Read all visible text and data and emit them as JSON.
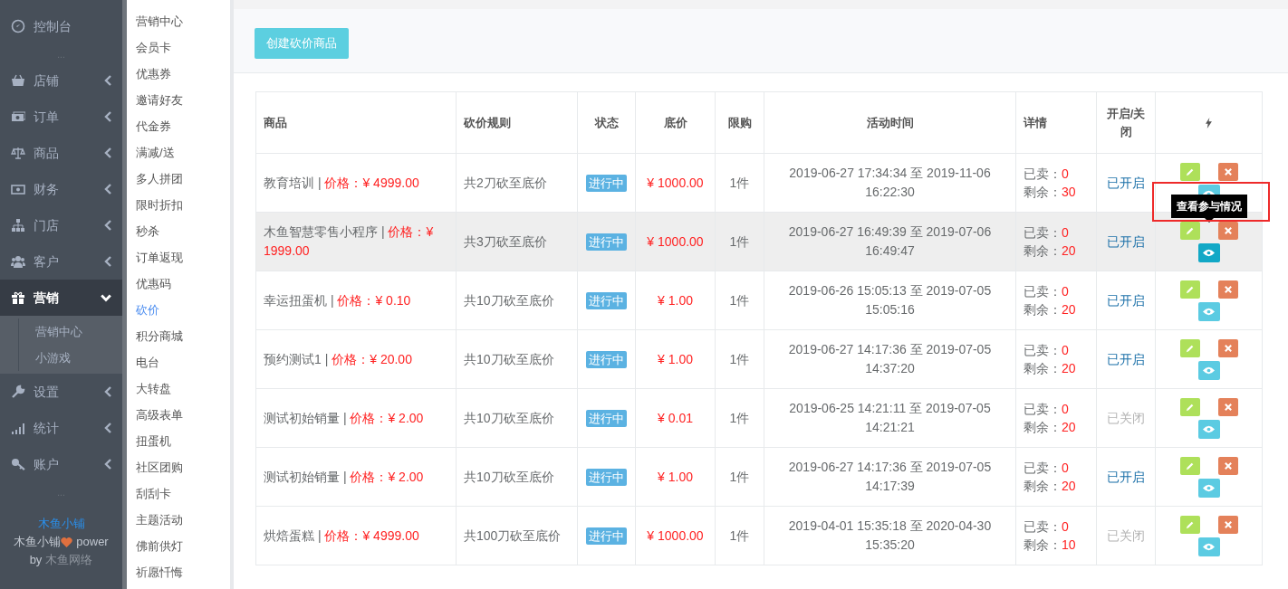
{
  "sidebar": {
    "items": [
      {
        "kind": "item",
        "label": "控制台",
        "has_submenu": false,
        "selected": false
      },
      {
        "kind": "divider",
        "label": "..."
      },
      {
        "kind": "item",
        "label": "店铺",
        "has_submenu": true,
        "expanded": false,
        "selected": false
      },
      {
        "kind": "item",
        "label": "订单",
        "has_submenu": true,
        "expanded": false,
        "selected": false
      },
      {
        "kind": "item",
        "label": "商品",
        "has_submenu": true,
        "expanded": false,
        "selected": false
      },
      {
        "kind": "item",
        "label": "财务",
        "has_submenu": true,
        "expanded": false,
        "selected": false
      },
      {
        "kind": "item",
        "label": "门店",
        "has_submenu": true,
        "expanded": false,
        "selected": false
      },
      {
        "kind": "item",
        "label": "客户",
        "has_submenu": true,
        "expanded": false,
        "selected": false
      },
      {
        "kind": "item",
        "label": "营销",
        "has_submenu": true,
        "expanded": true,
        "selected": true,
        "children": [
          {
            "label": "营销中心"
          },
          {
            "label": "小游戏"
          }
        ]
      },
      {
        "kind": "item",
        "label": "设置",
        "has_submenu": true,
        "expanded": false,
        "selected": false
      },
      {
        "kind": "item",
        "label": "统计",
        "has_submenu": true,
        "expanded": false,
        "selected": false
      },
      {
        "kind": "item",
        "label": "账户",
        "has_submenu": true,
        "expanded": false,
        "selected": false
      },
      {
        "kind": "divider",
        "label": "..."
      }
    ],
    "footer": {
      "brand": "木鱼小铺",
      "power_prefix": "木鱼小铺",
      "power_suffix": "power",
      "by_prefix": "by",
      "by_company": "木鱼网络"
    }
  },
  "submenu": [
    {
      "label": "营销中心",
      "selected": false
    },
    {
      "label": "会员卡",
      "selected": false
    },
    {
      "label": "优惠券",
      "selected": false
    },
    {
      "label": "邀请好友",
      "selected": false
    },
    {
      "label": "代金券",
      "selected": false
    },
    {
      "label": "满减/送",
      "selected": false
    },
    {
      "label": "多人拼团",
      "selected": false
    },
    {
      "label": "限时折扣",
      "selected": false
    },
    {
      "label": "秒杀",
      "selected": false
    },
    {
      "label": "订单返现",
      "selected": false
    },
    {
      "label": "优惠码",
      "selected": false
    },
    {
      "label": "砍价",
      "selected": true
    },
    {
      "label": "积分商城",
      "selected": false
    },
    {
      "label": "电台",
      "selected": false
    },
    {
      "label": "大转盘",
      "selected": false
    },
    {
      "label": "高级表单",
      "selected": false
    },
    {
      "label": "扭蛋机",
      "selected": false
    },
    {
      "label": "社区团购",
      "selected": false
    },
    {
      "label": "刮刮卡",
      "selected": false
    },
    {
      "label": "主题活动",
      "selected": false
    },
    {
      "label": "佛前供灯",
      "selected": false
    },
    {
      "label": "祈愿忏悔",
      "selected": false
    }
  ],
  "create_button": "创建砍价商品",
  "table": {
    "columns": [
      "商品",
      "砍价规则",
      "状态",
      "底价",
      "限购",
      "活动时间",
      "详情",
      "开启/关闭"
    ],
    "rows": [
      {
        "name": "教育培训 |",
        "price": "价格：¥ 4999.00",
        "rule": "共2刀砍至底价",
        "status": "进行中",
        "floor_price": "¥ 1000.00",
        "limit": "1件",
        "time": "2019-06-27 17:34:34 至 2019-11-06 16:22:30",
        "sold_label": "已卖：",
        "sold": "0",
        "remaining_label": "剩余：",
        "remaining": "30",
        "switch_label": "已开启",
        "enabled": true,
        "hovered": false
      },
      {
        "name": "木鱼智慧零售小程序 |",
        "price": "价格：¥ 1999.00",
        "rule": "共3刀砍至底价",
        "status": "进行中",
        "floor_price": "¥ 1000.00",
        "limit": "1件",
        "time": "2019-06-27 16:49:39 至 2019-07-06 16:49:47",
        "sold_label": "已卖：",
        "sold": "0",
        "remaining_label": "剩余：",
        "remaining": "20",
        "switch_label": "已开启",
        "enabled": true,
        "hovered": true,
        "tooltip": "查看参与情况",
        "highlighted": true
      },
      {
        "name": "幸运扭蛋机 |",
        "price": "价格：¥ 0.10",
        "rule": "共10刀砍至底价",
        "status": "进行中",
        "floor_price": "¥ 1.00",
        "limit": "1件",
        "time": "2019-06-26 15:05:13 至 2019-07-05 15:05:16",
        "sold_label": "已卖：",
        "sold": "0",
        "remaining_label": "剩余：",
        "remaining": "20",
        "switch_label": "已开启",
        "enabled": true,
        "hovered": false
      },
      {
        "name": "预约测试1 |",
        "price": "价格：¥ 20.00",
        "rule": "共10刀砍至底价",
        "status": "进行中",
        "floor_price": "¥ 1.00",
        "limit": "1件",
        "time": "2019-06-27 14:17:36 至 2019-07-05 14:37:20",
        "sold_label": "已卖：",
        "sold": "0",
        "remaining_label": "剩余：",
        "remaining": "20",
        "switch_label": "已开启",
        "enabled": true,
        "hovered": false
      },
      {
        "name": "测试初始销量 |",
        "price": "价格：¥ 2.00",
        "rule": "共10刀砍至底价",
        "status": "进行中",
        "floor_price": "¥ 0.01",
        "limit": "1件",
        "time": "2019-06-25 14:21:11 至 2019-07-05 14:21:21",
        "sold_label": "已卖：",
        "sold": "0",
        "remaining_label": "剩余：",
        "remaining": "20",
        "switch_label": "已关闭",
        "enabled": false,
        "hovered": false
      },
      {
        "name": "测试初始销量 |",
        "price": "价格：¥ 2.00",
        "rule": "共10刀砍至底价",
        "status": "进行中",
        "floor_price": "¥ 1.00",
        "limit": "1件",
        "time": "2019-06-27 14:17:36 至 2019-07-05 14:17:39",
        "sold_label": "已卖：",
        "sold": "0",
        "remaining_label": "剩余：",
        "remaining": "20",
        "switch_label": "已开启",
        "enabled": true,
        "hovered": false
      },
      {
        "name": "烘焙蛋糕 |",
        "price": "价格：¥ 4999.00",
        "rule": "共100刀砍至底价",
        "status": "进行中",
        "floor_price": "¥ 1000.00",
        "limit": "1件",
        "time": "2019-04-01 15:35:18 至 2020-04-30 15:35:20",
        "sold_label": "已卖：",
        "sold": "0",
        "remaining_label": "剩余：",
        "remaining": "10",
        "switch_label": "已关闭",
        "enabled": false,
        "hovered": false
      }
    ]
  }
}
